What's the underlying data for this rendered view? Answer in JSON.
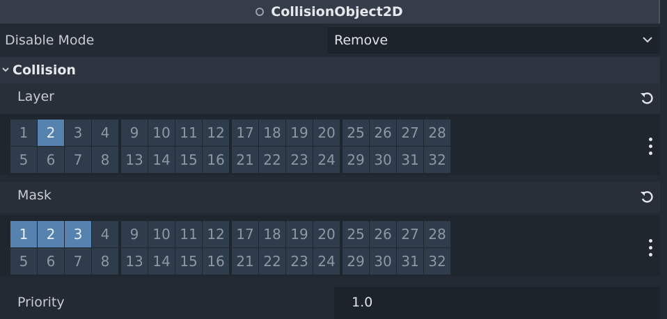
{
  "header": {
    "title": "CollisionObject2D",
    "icon": "circle-outline-icon"
  },
  "disable_mode": {
    "label": "Disable Mode",
    "value": "Remove"
  },
  "collision": {
    "title": "Collision"
  },
  "layer": {
    "label": "Layer",
    "enabled": [
      2
    ]
  },
  "mask": {
    "label": "Mask",
    "enabled": [
      1,
      2,
      3
    ]
  },
  "layout_cells": [
    [
      1,
      2,
      3,
      4,
      9,
      10,
      11,
      12,
      17,
      18,
      19,
      20,
      25,
      26,
      27,
      28
    ],
    [
      5,
      6,
      7,
      8,
      13,
      14,
      15,
      16,
      21,
      22,
      23,
      24,
      29,
      30,
      31,
      32
    ]
  ],
  "priority": {
    "label": "Priority",
    "value": "1.0"
  },
  "colors": {
    "accent": "#5582ae",
    "cell": "#2e3c4b"
  }
}
